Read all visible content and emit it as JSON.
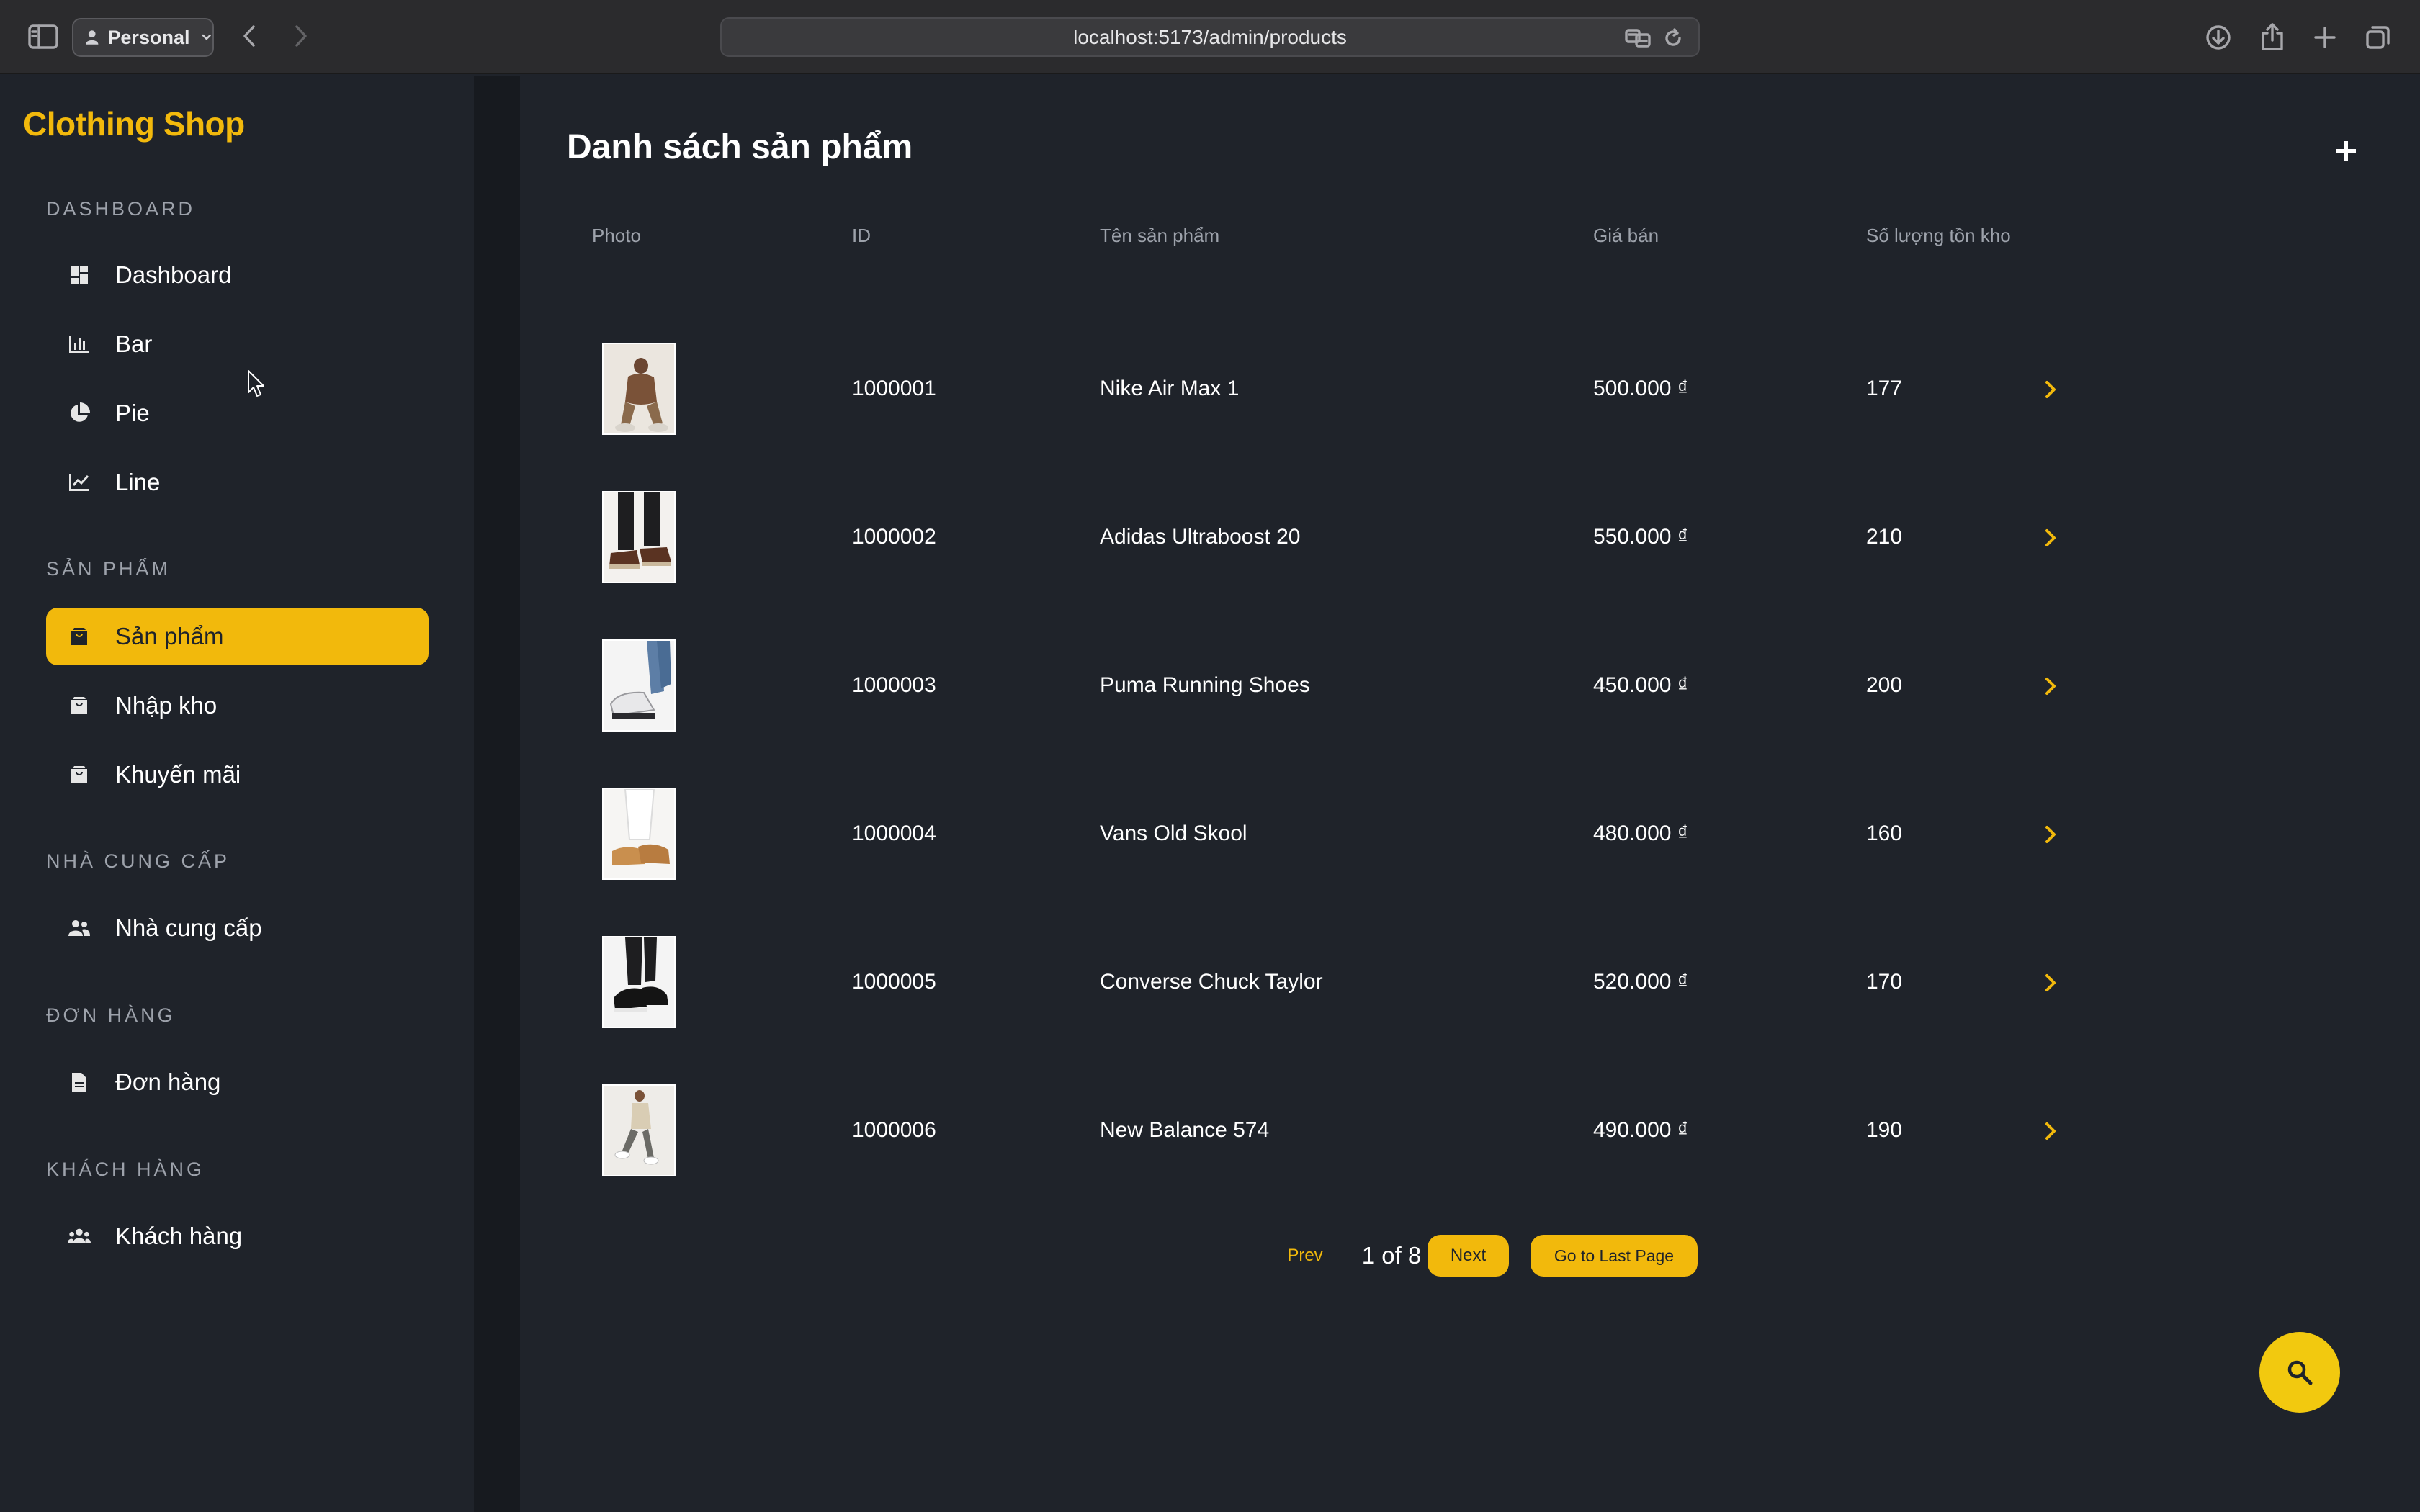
{
  "browser": {
    "profile": "Personal",
    "url": "localhost:5173/admin/products",
    "icons": [
      "sidebar-toggle-icon",
      "back-icon",
      "forward-icon",
      "translate-icon",
      "reload-icon",
      "download-icon",
      "share-icon",
      "new-tab-icon",
      "tabs-overview-icon"
    ]
  },
  "sidebar": {
    "brand": "Clothing Shop",
    "sections": [
      {
        "title": "DASHBOARD",
        "items": [
          {
            "label": "Dashboard",
            "icon": "dashboard-icon"
          },
          {
            "label": "Bar",
            "icon": "bar-chart-icon"
          },
          {
            "label": "Pie",
            "icon": "pie-chart-icon"
          },
          {
            "label": "Line",
            "icon": "line-chart-icon"
          }
        ]
      },
      {
        "title": "SẢN PHẨM",
        "items": [
          {
            "label": "Sản phẩm",
            "icon": "shopping-bag-icon",
            "active": true
          },
          {
            "label": "Nhập kho",
            "icon": "shopping-bag-icon"
          },
          {
            "label": "Khuyến mãi",
            "icon": "shopping-bag-icon"
          }
        ]
      },
      {
        "title": "NHÀ CUNG CẤP",
        "items": [
          {
            "label": "Nhà cung cấp",
            "icon": "supplier-people-icon"
          }
        ]
      },
      {
        "title": "ĐƠN HÀNG",
        "items": [
          {
            "label": "Đơn hàng",
            "icon": "document-icon"
          }
        ]
      },
      {
        "title": "KHÁCH HÀNG",
        "items": [
          {
            "label": "Khách hàng",
            "icon": "customer-group-icon"
          }
        ]
      }
    ]
  },
  "main": {
    "title": "Danh sách sản phẩm",
    "columns": [
      "Photo",
      "ID",
      "Tên sản phẩm",
      "Giá bán",
      "Số lượng tồn kho"
    ],
    "rows": [
      {
        "id": "1000001",
        "name": "Nike Air Max 1",
        "price": "500.000 ₫",
        "stock": "177"
      },
      {
        "id": "1000002",
        "name": "Adidas Ultraboost 20",
        "price": "550.000 ₫",
        "stock": "210"
      },
      {
        "id": "1000003",
        "name": "Puma Running Shoes",
        "price": "450.000 ₫",
        "stock": "200"
      },
      {
        "id": "1000004",
        "name": "Vans Old Skool",
        "price": "480.000 ₫",
        "stock": "160"
      },
      {
        "id": "1000005",
        "name": "Converse Chuck Taylor",
        "price": "520.000 ₫",
        "stock": "170"
      },
      {
        "id": "1000006",
        "name": "New Balance 574",
        "price": "490.000 ₫",
        "stock": "190"
      }
    ],
    "pagination": {
      "prev": "Prev",
      "page_info": "1 of 8",
      "next": "Next",
      "last": "Go to Last Page"
    }
  },
  "colors": {
    "accent": "#f2b90c",
    "background": "#1f232a",
    "muted": "#9da2ab"
  }
}
